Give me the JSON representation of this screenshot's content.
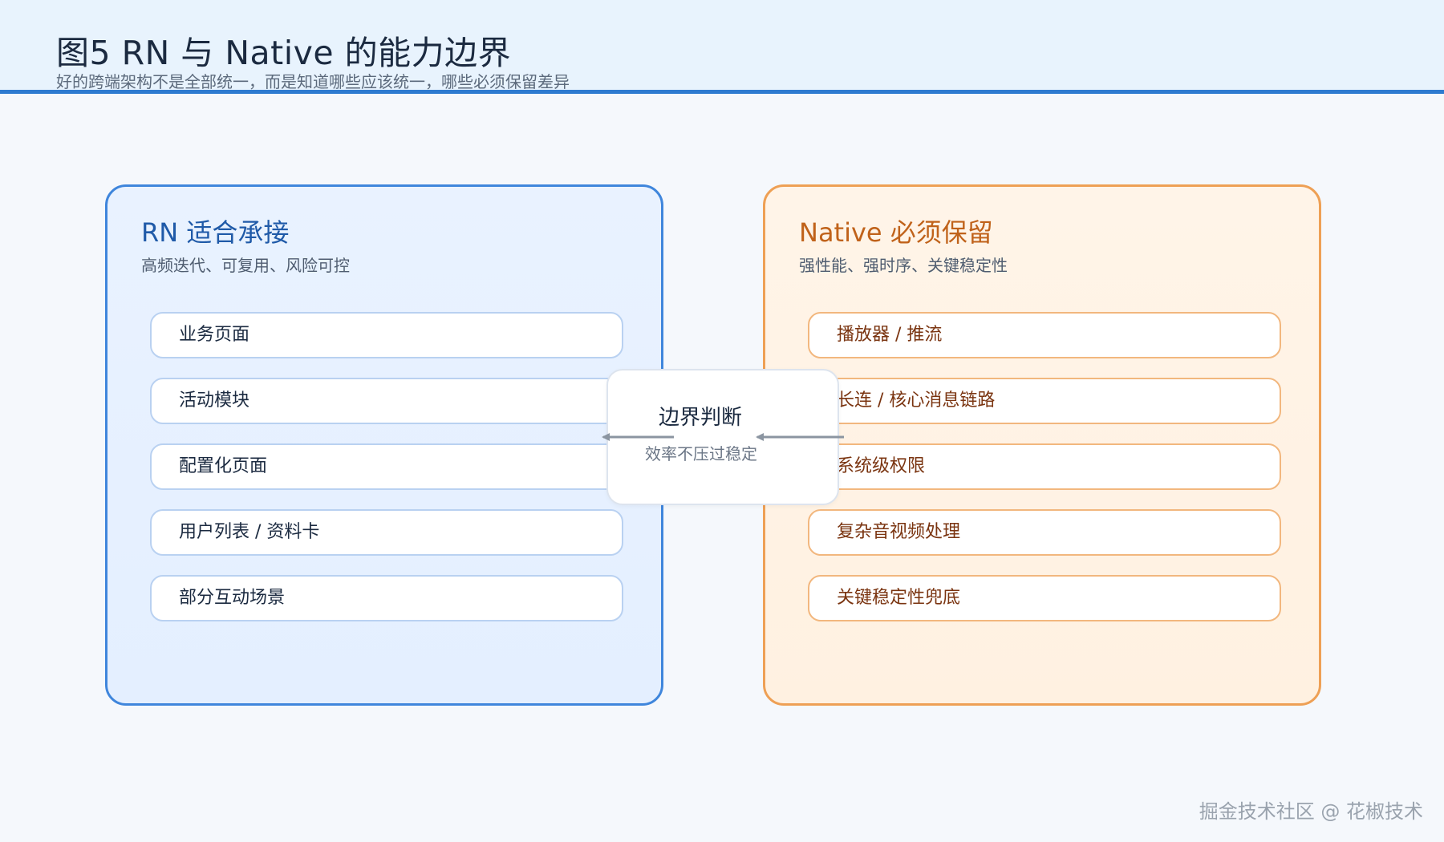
{
  "header": {
    "title": "图5 RN 与 Native 的能力边界",
    "subtitle": "好的跨端架构不是全部统一，而是知道哪些应该统一，哪些必须保留差异"
  },
  "left_panel": {
    "title": "RN 适合承接",
    "subtitle": "高频迭代、可复用、风险可控",
    "items": [
      "业务页面",
      "活动模块",
      "配置化页面",
      "用户列表 / 资料卡",
      "部分互动场景"
    ]
  },
  "right_panel": {
    "title": "Native 必须保留",
    "subtitle": "强性能、强时序、关键稳定性",
    "items": [
      "播放器 / 推流",
      "长连 / 核心消息链路",
      "系统级权限",
      "复杂音视频处理",
      "关键稳定性兜底"
    ]
  },
  "center": {
    "title": "边界判断",
    "subtitle": "效率不压过稳定"
  },
  "watermark": "掘金技术社区 @ 花椒技术",
  "colors": {
    "header_bg": "#e8f3fd",
    "header_line": "#2e7bd0",
    "left_border": "#3f86dc",
    "left_title": "#1f5aa8",
    "right_border": "#eea055",
    "right_title": "#c0621a",
    "arrow": "#8b95a1"
  }
}
